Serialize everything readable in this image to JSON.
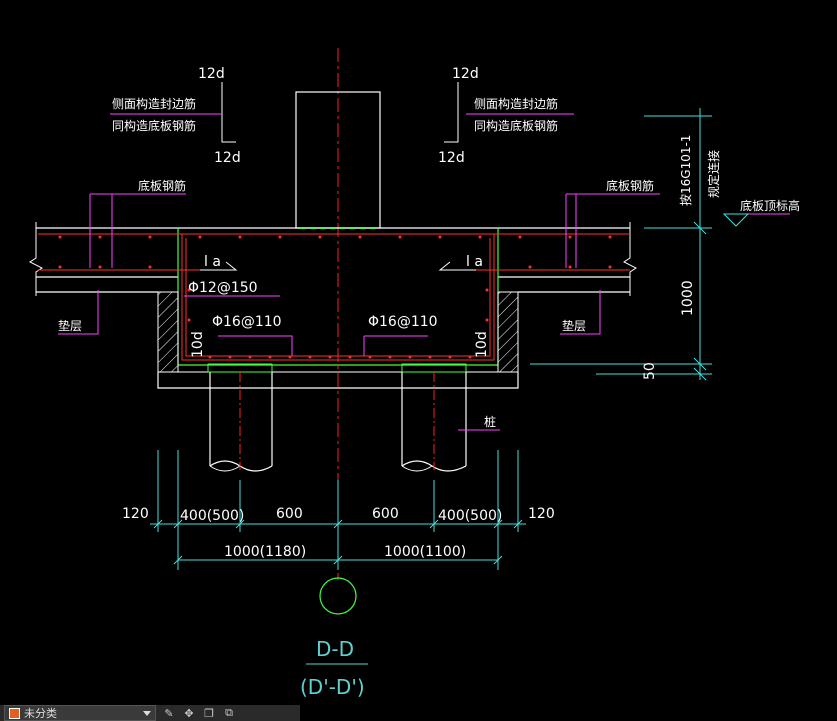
{
  "labels": {
    "side_seal_left": "侧面构造封边筋",
    "bottom_construct_left": "同构造底板钢筋",
    "side_seal_right": "侧面构造封边筋",
    "bottom_construct_right": "同构造底板钢筋",
    "bottom_rebar_left": "底板钢筋",
    "bottom_rebar_right": "底板钢筋",
    "cushion_left": "垫层",
    "cushion_right": "垫层",
    "pile": "桩",
    "anchor_note": "按16G101-1",
    "anchor_note2": "规定连接",
    "slab_top_elev": "底板顶标高",
    "twelve_d_tl": "12d",
    "twelve_d_bl": "12d",
    "twelve_d_tr": "12d",
    "twelve_d_br": "12d",
    "la_left": "l a",
    "la_right": "l a",
    "ten_d_left": "10d",
    "ten_d_right": "10d",
    "stirrup": "Φ12@150",
    "rebar_left": "Φ16@110",
    "rebar_right": "Φ16@110"
  },
  "dimensions": {
    "d1000": "1000",
    "d50": "50",
    "d120_left": "120",
    "d400_left": "400(500)",
    "d600_left": "600",
    "d600_right": "600",
    "d400_right": "400(500)",
    "d120_right": "120",
    "d1000_left": "1000(1180)",
    "d1000_right": "1000(1100)"
  },
  "section_title": {
    "main": "D-D",
    "alt": "(D'-D')"
  },
  "statusbar": {
    "layer_name": "未分类",
    "icons": [
      "edit-icon",
      "move-icon",
      "copy-icon",
      "layer-icon"
    ]
  },
  "colors": {
    "background": "#000000",
    "outline": "#ffffff",
    "concrete_hatch": "#ffffff",
    "rebar": "#ff3030",
    "leader": "#ff40ff",
    "dimension": "#40e0e0",
    "centerline": "#ff2020",
    "pile_outline": "#ffffff",
    "pile_cap_green": "#40ff40",
    "ground_green": "#40ff40",
    "title": "#5fd0d0"
  }
}
